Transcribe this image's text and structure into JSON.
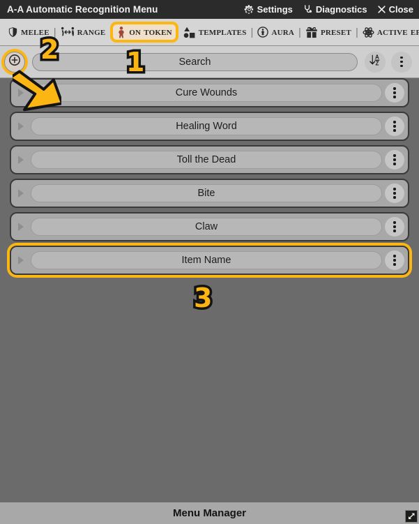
{
  "titlebar": {
    "title": "A-A Automatic Recognition Menu",
    "actions": [
      {
        "label": "Settings",
        "icon": "gear-icon",
        "name": "settings-button"
      },
      {
        "label": "Diagnostics",
        "icon": "stethoscope-icon",
        "name": "diagnostics-button"
      },
      {
        "label": "Close",
        "icon": "close-icon",
        "name": "close-button"
      }
    ]
  },
  "tabs": [
    {
      "label": "Melee",
      "icon": "shield-icon",
      "active": false
    },
    {
      "label": "Range",
      "icon": "range-icon",
      "active": false
    },
    {
      "label": "On Token",
      "icon": "person-icon",
      "active": true
    },
    {
      "label": "Templates",
      "icon": "shapes-icon",
      "active": false
    },
    {
      "label": "Aura",
      "icon": "aura-icon",
      "active": false
    },
    {
      "label": "Preset",
      "icon": "gift-icon",
      "active": false
    },
    {
      "label": "Active Effects",
      "icon": "atom-icon",
      "active": false
    }
  ],
  "tab_separator": "|",
  "toolbar": {
    "add_label": "+",
    "add_icon": "plus-icon",
    "sort_icon": "sort-az-icon",
    "sort_label": "AZ",
    "menu_icon": "kebab-menu-icon"
  },
  "search": {
    "value": "",
    "placeholder": "Search"
  },
  "items": [
    {
      "name": "Cure Wounds",
      "highlight": false,
      "expanded": false
    },
    {
      "name": "Healing Word",
      "highlight": false,
      "expanded": false
    },
    {
      "name": "Toll the Dead",
      "highlight": false,
      "expanded": false
    },
    {
      "name": "Bite",
      "highlight": false,
      "expanded": false
    },
    {
      "name": "Claw",
      "highlight": false,
      "expanded": false
    },
    {
      "name": "Item Name",
      "highlight": true,
      "expanded": false
    }
  ],
  "footer": {
    "label": "Menu Manager",
    "resize_icon": "resize-handle-icon"
  },
  "annotations": {
    "badges": [
      {
        "id": "badge1",
        "label": "1",
        "target": "on-token-tab"
      },
      {
        "id": "badge2",
        "label": "2",
        "target": "add-button"
      },
      {
        "id": "badge3",
        "label": "3",
        "target": "item-name-row"
      }
    ],
    "cursor": "arrow-cursor",
    "highlight_color": "#fbb614"
  },
  "colors": {
    "titlebar_bg": "#2b2b2b",
    "tabbar_bg": "#d5d5d5",
    "body_bg": "#6b6b6b",
    "row_bg": "#a8a8a8",
    "accent": "#fbb614"
  }
}
